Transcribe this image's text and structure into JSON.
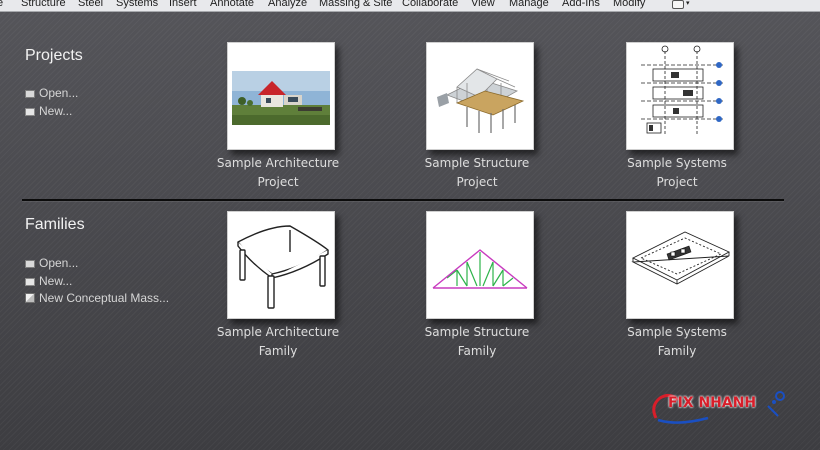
{
  "ribbon": {
    "tabs": [
      "e",
      "Structure",
      "Steel",
      "Systems",
      "Insert",
      "Annotate",
      "Analyze",
      "Massing & Site",
      "Collaborate",
      "View",
      "Manage",
      "Add-Ins",
      "Modify"
    ]
  },
  "projects": {
    "title": "Projects",
    "links": [
      "Open...",
      "New..."
    ],
    "tiles": [
      {
        "line1": "Sample Architecture",
        "line2": "Project"
      },
      {
        "line1": "Sample Structure",
        "line2": "Project"
      },
      {
        "line1": "Sample Systems",
        "line2": "Project"
      }
    ]
  },
  "families": {
    "title": "Families",
    "links": [
      "Open...",
      "New...",
      "New Conceptual Mass..."
    ],
    "tiles": [
      {
        "line1": "Sample Architecture",
        "line2": "Family"
      },
      {
        "line1": "Sample Structure",
        "line2": "Family"
      },
      {
        "line1": "Sample Systems",
        "line2": "Family"
      }
    ]
  },
  "watermark": {
    "text": "FIX NHANH"
  },
  "colors": {
    "background": "#46464a",
    "ribbon": "#e8e9ec",
    "accent_red": "#d81e2a",
    "watermark_blue": "#1a4fc2"
  }
}
